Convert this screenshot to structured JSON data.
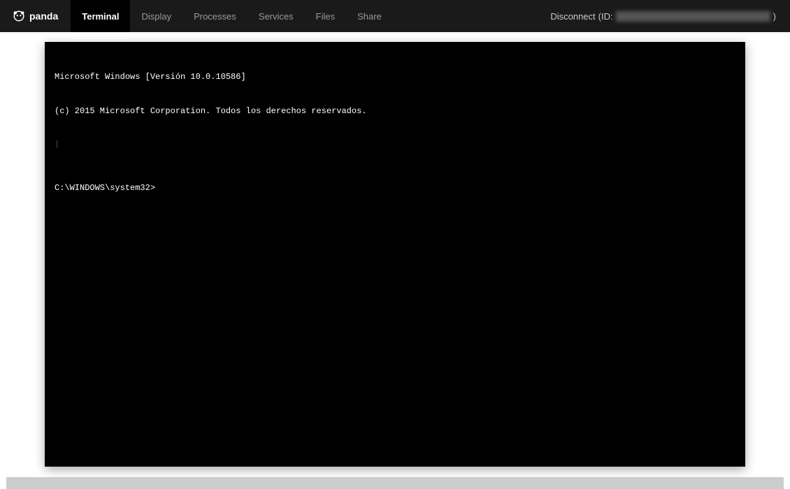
{
  "brand": "panda",
  "nav": {
    "tabs": [
      {
        "label": "Terminal",
        "active": true
      },
      {
        "label": "Display",
        "active": false
      },
      {
        "label": "Processes",
        "active": false
      },
      {
        "label": "Services",
        "active": false
      },
      {
        "label": "Files",
        "active": false
      },
      {
        "label": "Share",
        "active": false
      }
    ]
  },
  "disconnect": {
    "label": "Disconnect",
    "id_prefix": "(ID:",
    "id_value": "████████████████████████",
    "id_suffix": ")"
  },
  "terminal": {
    "line1": "Microsoft Windows [Versión 10.0.10586]",
    "line2": "(c) 2015 Microsoft Corporation. Todos los derechos reservados.",
    "cursor_marker": "|",
    "prompt": "C:\\WINDOWS\\system32>"
  }
}
